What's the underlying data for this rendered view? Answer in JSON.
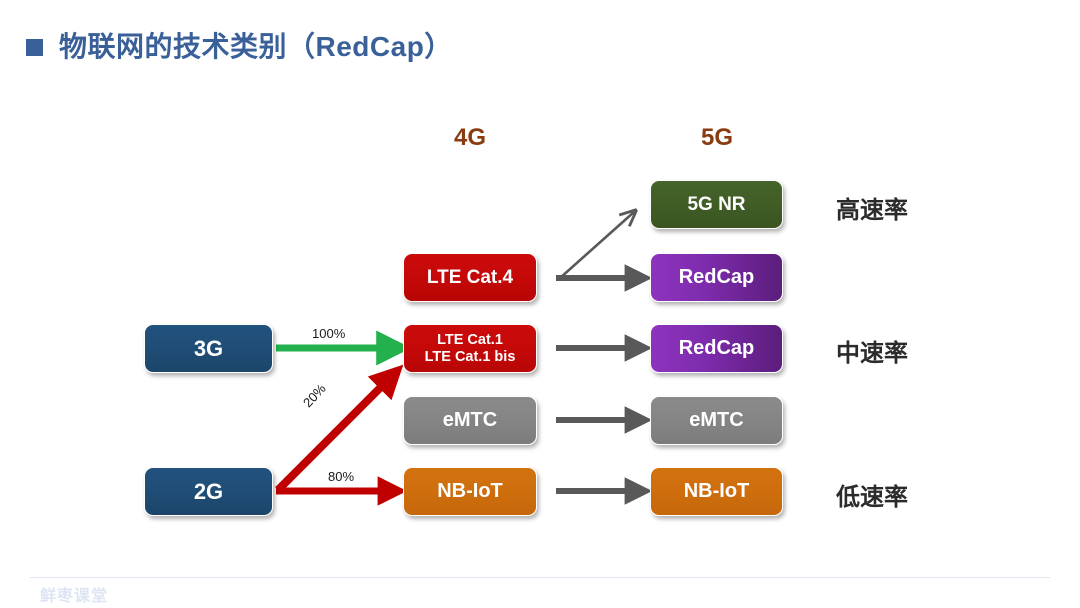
{
  "slide": {
    "title": "物联网的技术类别（RedCap）",
    "bullet_icon": "square-bullet-icon",
    "title_color": "#3a6099"
  },
  "columns": {
    "gen4_header": "4G",
    "gen5_header": "5G",
    "header_color": "#8a3c10"
  },
  "legacy_nodes": [
    {
      "label": "3G",
      "color": "#1f4d77"
    },
    {
      "label": "2G",
      "color": "#1f4d77"
    }
  ],
  "gen4_nodes": [
    {
      "label": "LTE Cat.4",
      "color": "#c40808"
    },
    {
      "label": "LTE Cat.1\nLTE Cat.1 bis",
      "line1": "LTE Cat.1",
      "line2": "LTE Cat.1 bis",
      "color": "#c40808"
    },
    {
      "label": "eMTC",
      "color": "#848484"
    },
    {
      "label": "NB-IoT",
      "color": "#cd6d0d"
    }
  ],
  "gen5_nodes": [
    {
      "label": "5G NR",
      "color": "#3f5c25"
    },
    {
      "label": "RedCap",
      "color": "#7e2cae"
    },
    {
      "label": "RedCap",
      "color": "#7e2cae"
    },
    {
      "label": "eMTC",
      "color": "#848484"
    },
    {
      "label": "NB-IoT",
      "color": "#cd6d0d"
    }
  ],
  "rate_labels": [
    {
      "label": "高速率"
    },
    {
      "label": "中速率"
    },
    {
      "label": "低速率"
    }
  ],
  "migration_labels": {
    "from_3g_to_ltecat1": "100%",
    "from_2g_to_ltecat1": "20%",
    "from_2g_to_nbiot": "80%"
  },
  "arrow_colors": {
    "green": "#22b14c",
    "red": "#c00000",
    "gray": "#595959"
  },
  "footer": {
    "watermark": "鲜枣课堂"
  }
}
